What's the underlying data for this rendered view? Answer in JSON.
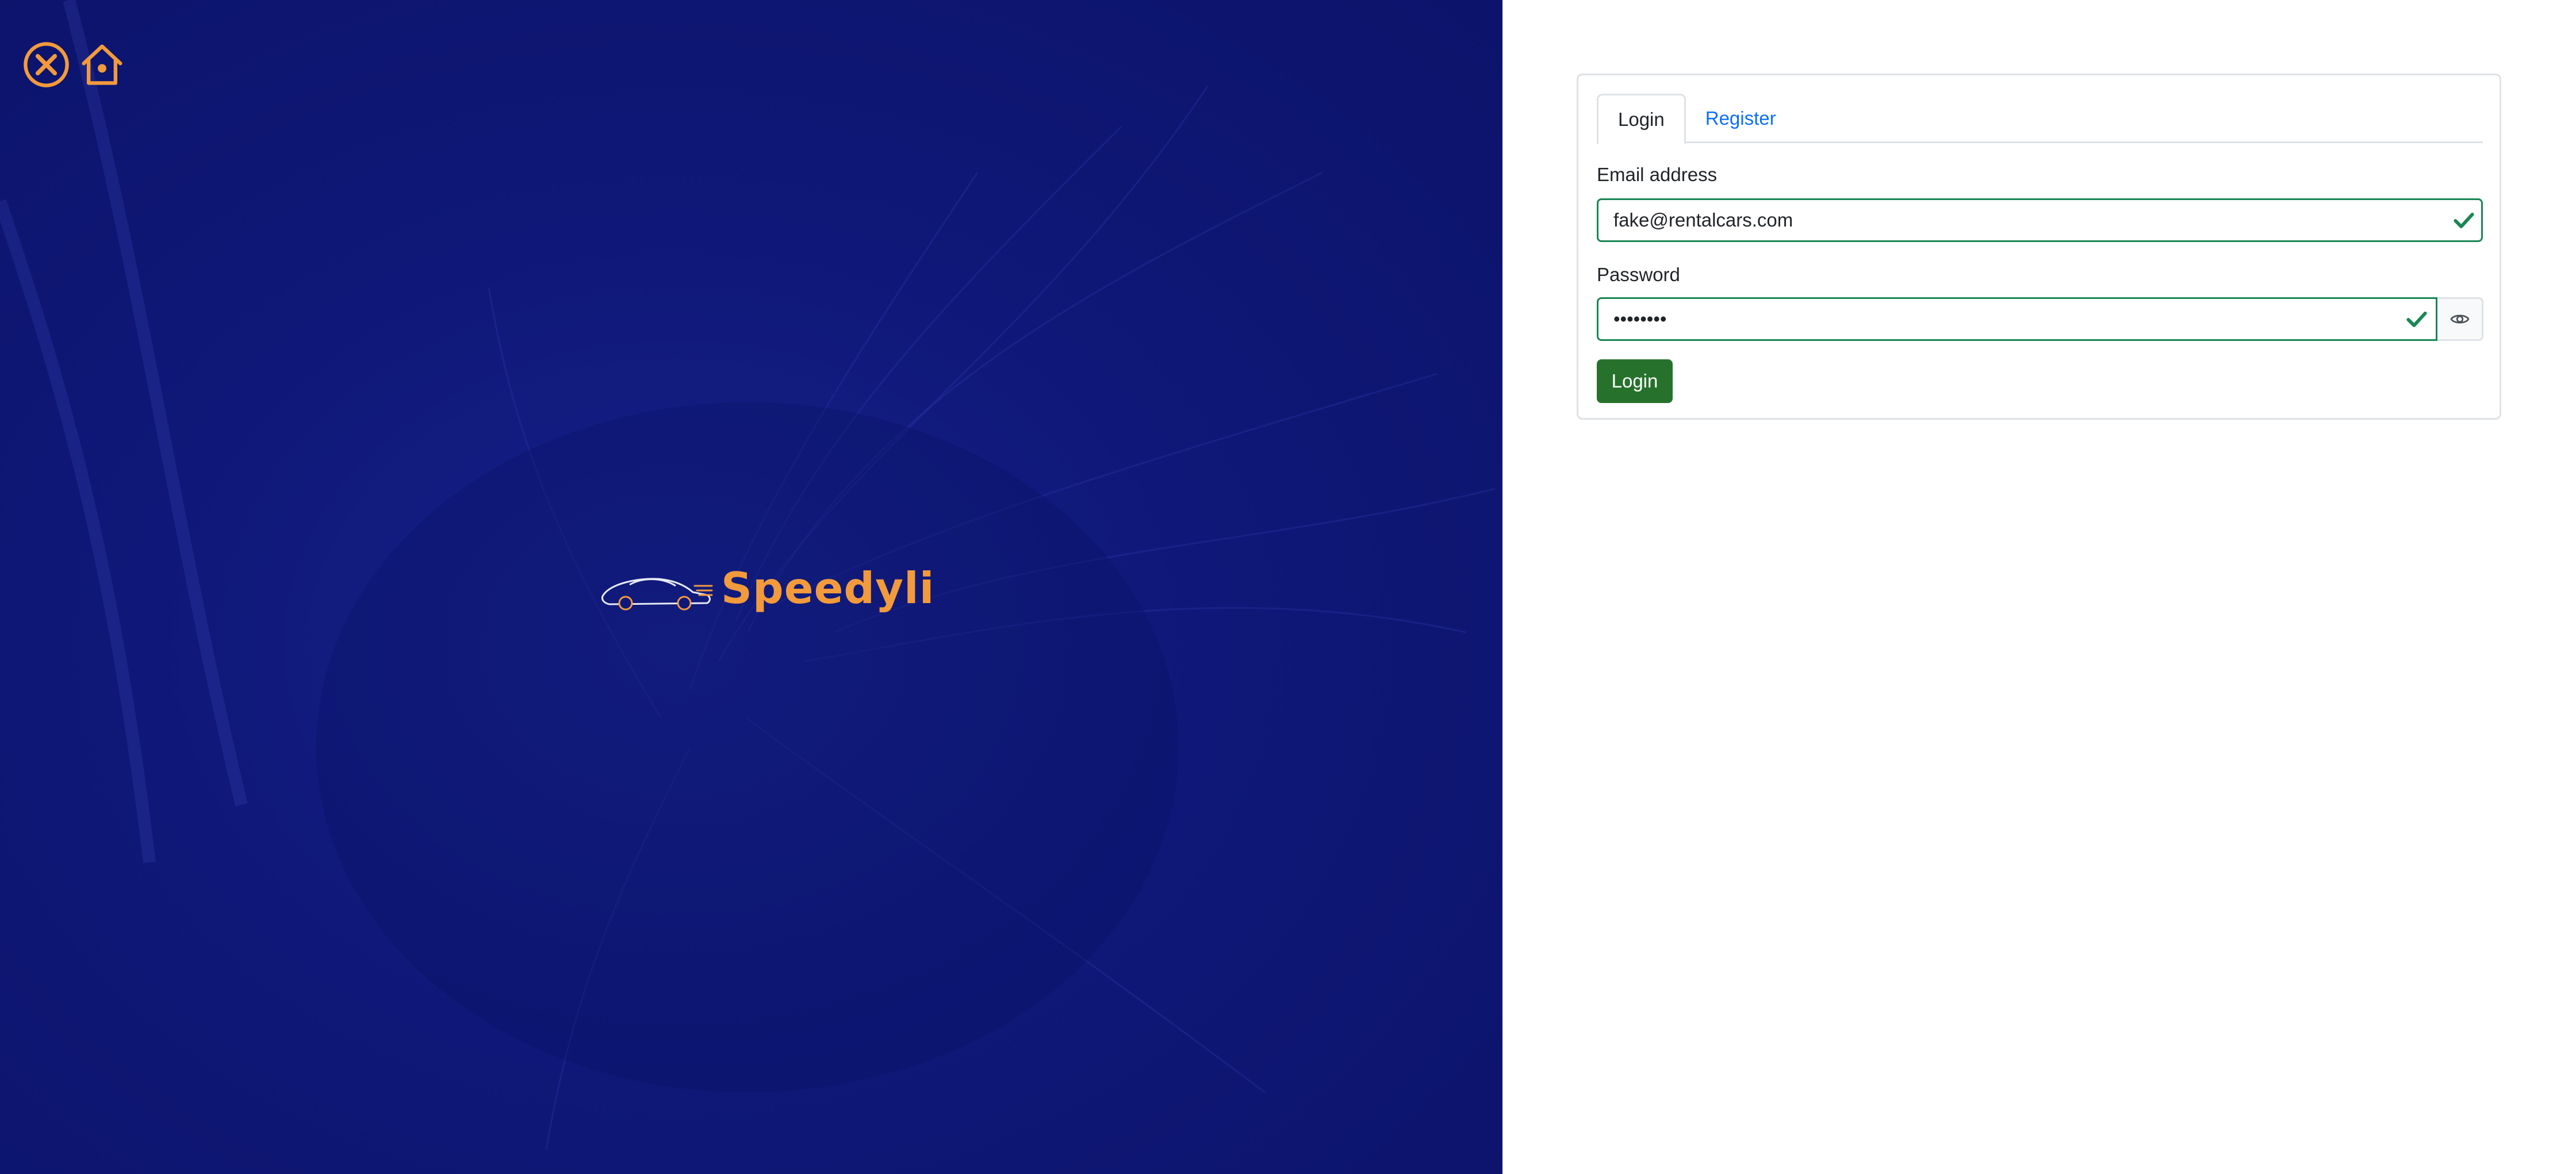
{
  "hero": {
    "brand_name": "Speedyli",
    "icons": [
      "close-circle-icon",
      "home-icon"
    ],
    "accent_color": "#f29a3c",
    "background_color": "#0f1878"
  },
  "auth": {
    "tabs": [
      {
        "label": "Login",
        "active": true
      },
      {
        "label": "Register",
        "active": false
      }
    ],
    "email": {
      "label": "Email address",
      "value": "fake@rentalcars.com",
      "valid": true
    },
    "password": {
      "label": "Password",
      "value": "••••••••",
      "valid": true,
      "toggle_icon": "eye-icon"
    },
    "submit_label": "Login",
    "colors": {
      "valid": "#198754",
      "submit": "#26722c",
      "link": "#0d6efd"
    }
  }
}
